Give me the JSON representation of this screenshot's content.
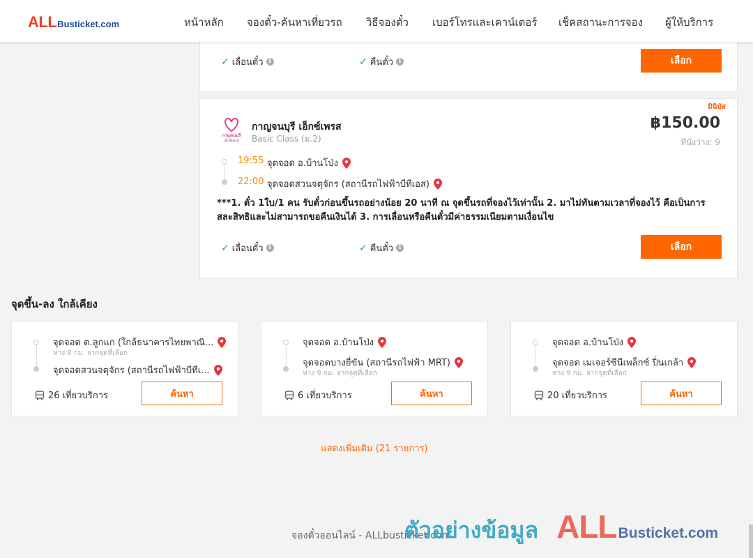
{
  "brand": {
    "logo_main": "ALL",
    "logo_rest": "Busticket.com"
  },
  "nav": {
    "items": [
      {
        "label": "หน้าหลัก"
      },
      {
        "label": "จองตั๋ว-ค้นหาเที่ยวรถ"
      },
      {
        "label": "วิธีจองตั๋ว"
      },
      {
        "label": "เบอร์โทรและเคาน์เตอร์"
      },
      {
        "label": "เช็คสถานะการจอง"
      },
      {
        "label": "ผู้ให้บริการ"
      }
    ]
  },
  "top_card": {
    "features": {
      "change": "เลื่อนตั๋ว",
      "refund": "คืนตั๋ว"
    },
    "select_label": "เลือก"
  },
  "trip": {
    "badge": "มินิบัส",
    "operator": "กาญจนบุรี เอ็กซ์เพรส",
    "operator_logo_text": "กาญจนบุรี เอ็กซ์เพรส",
    "class": "Basic Class (ม.2)",
    "price": "฿150.00",
    "seats": "ที่นั่งว่าง: 9",
    "depart_time": "19:55",
    "depart_stop": "จุดจอด อ.บ้านโป่ง",
    "arrive_time": "22:00",
    "arrive_stop": "จุดจอดสวนจตุจักร (สถานีรถไฟฟ้าบีทีเอส)",
    "notes": "***1. ตั๋ว 1ใบ/1 คน รับตั๋วก่อนขึ้นรถอย่างน้อย 20 นาที ณ จุดขึ้นรถที่จองไว้เท่านั้น 2. มาไม่ทันตามเวลาที่จองไว้ คือเป็นการสละสิทธิและไม่สามารถขอคืนเงินได้ 3. การเลื่อนหรือคืนตั๋วมีค่าธรรมเนียมตามเงื่อนไข",
    "features": {
      "change": "เลื่อนตั๋ว",
      "refund": "คืนตั๋ว"
    },
    "select_label": "เลือก"
  },
  "nearby": {
    "title": "จุดขึ้น-ลง ใกล้เคียง",
    "cards": [
      {
        "from": "จุดจอด ต.ลูกแก (ใกล้ธนาคารไทยพาณิ...",
        "from_dist": "ห่าง 8 กม. จากจุดที่เลือก",
        "to": "จุดจอดสวนจตุจักร (สถานีรถไฟฟ้าบีทีเ...",
        "to_dist": "",
        "trips": "26 เที่ยวบริการ",
        "search_label": "ค้นหา"
      },
      {
        "from": "จุดจอด อ.บ้านโป่ง",
        "from_dist": "",
        "to": "จุดจอดบางยี่ขัน (สถานีรถไฟฟ้า MRT)",
        "to_dist": "ห่าง 9 กม. จากจุดที่เลือก",
        "trips": "6 เที่ยวบริการ",
        "search_label": "ค้นหา"
      },
      {
        "from": "จุดจอด อ.บ้านโป่ง",
        "from_dist": "",
        "to": "จุดจอด เมเจอร์ซีนีเพล็กซ์ ปิ่นเกล้า",
        "to_dist": "ห่าง 9 กม. จากจุดที่เลือก",
        "trips": "20 เที่ยวบริการ",
        "search_label": "ค้นหา"
      }
    ]
  },
  "show_more": "แสดงเพิ่มเติม (21 รายการ)",
  "footer": "จองตั๋วออนไลน์ - ALLbusticket.com",
  "watermark": {
    "thai": "ตัวอย่างข้อมูล",
    "all": "ALL",
    "rest": "Busticket.com"
  },
  "colors": {
    "accent": "#ff6600",
    "time": "#ff8a00",
    "check": "#2aa547",
    "pin": "#e8353b",
    "brand_red": "#e8452c",
    "brand_blue": "#1f4e96"
  }
}
